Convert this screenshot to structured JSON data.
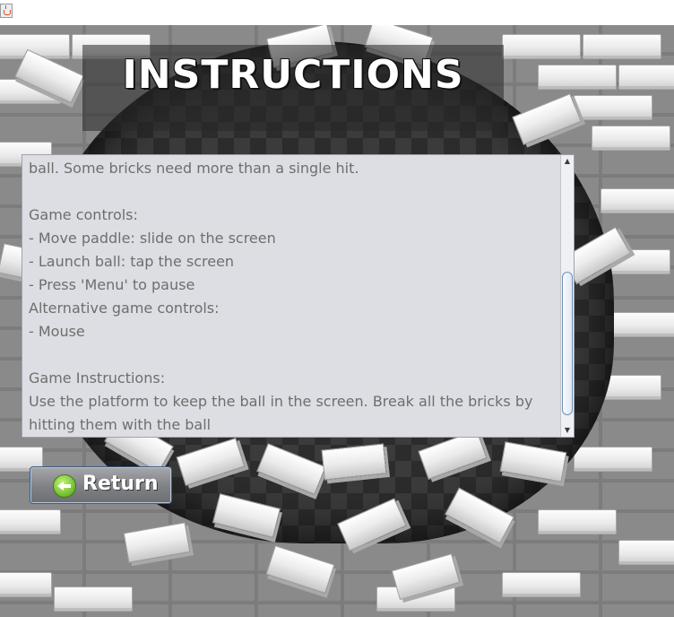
{
  "window": {
    "title_icon": "java-icon"
  },
  "screen": {
    "title": "INSTRUCTIONS"
  },
  "instructions": {
    "lines": [
      "ball. Some bricks need more than a single hit.",
      "",
      "Game controls:",
      "- Move paddle: slide on the screen",
      "- Launch ball: tap the screen",
      "- Press 'Menu' to pause",
      "Alternative game controls:",
      "- Mouse",
      "",
      "Game Instructions:",
      "Use the platform to keep the ball in the screen. Break all the bricks by",
      "hitting them with the ball"
    ],
    "scroll_arrow_up": "▲",
    "scroll_arrow_down": "▼"
  },
  "buttons": {
    "return_label": "Return",
    "return_icon": "back-arrow-icon"
  },
  "colors": {
    "panel_bg": "#dcdee3",
    "panel_text": "#6e6e6e",
    "title_text": "#ffffff",
    "return_icon_green": "#7fc93a",
    "scroll_thumb_border": "#6f8fb3"
  }
}
